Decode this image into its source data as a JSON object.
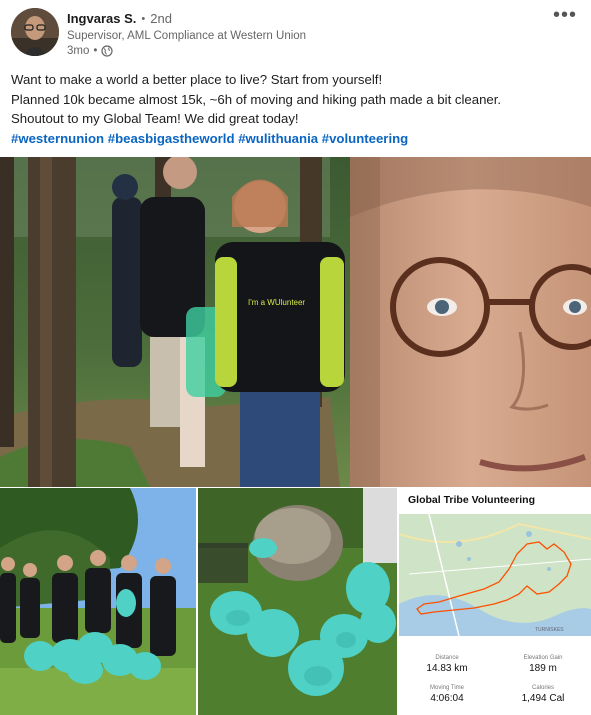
{
  "author": {
    "name": "Ingvaras S.",
    "degree": "2nd",
    "headline": "Supervisor, AML Compliance at Western Union",
    "time": "3mo"
  },
  "post": {
    "line1": "Want to make a world a better place to live? Start from yourself!",
    "line2": "Planned 10k became almost 15k, ~6h of moving and hiking path made a bit cleaner.",
    "line3": "Shoutout to my Global Team! We did great today!",
    "hashtags": [
      "#westernunion",
      "#beasbigastheworld",
      "#wulithuania",
      "#volunteering"
    ]
  },
  "shirt_text": "I'm a WUlunteer",
  "activity": {
    "title": "Global Tribe Volunteering",
    "map_label": "TURNISKES",
    "stats": [
      {
        "label": "Distance",
        "value": "14.83 km"
      },
      {
        "label": "Elevation Gain",
        "value": "189 m"
      },
      {
        "label": "Moving Time",
        "value": "4:06:04"
      },
      {
        "label": "Calories",
        "value": "1,494 Cal"
      }
    ]
  },
  "colors": {
    "hashtag": "#0a66c2",
    "route": "#fc5200",
    "bag": "#4fd1c5"
  }
}
